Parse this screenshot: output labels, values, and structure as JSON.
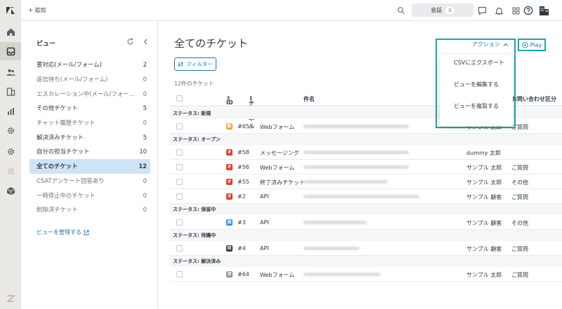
{
  "topbar": {
    "add_label": "+ 追加",
    "conversations_label": "会話",
    "conversations_count": "0"
  },
  "views": {
    "title": "ビュー",
    "items": [
      {
        "label": "要対応(メール/フォーム)",
        "count": "2",
        "dim": false
      },
      {
        "label": "返信待ち(メール/フォーム)",
        "count": "0",
        "dim": true
      },
      {
        "label": "エスカレーション中(メール/フォー…",
        "count": "0",
        "dim": true
      },
      {
        "label": "その他チケット",
        "count": "5",
        "dim": false
      },
      {
        "label": "チャット履歴チケット",
        "count": "0",
        "dim": true
      },
      {
        "label": "解決済みチケット",
        "count": "5",
        "dim": false
      },
      {
        "label": "自分の担当チケット",
        "count": "10",
        "dim": false
      },
      {
        "label": "全てのチケット",
        "count": "12",
        "dim": false,
        "active": true
      },
      {
        "label": "CSATアンケート回答あり",
        "count": "0",
        "dim": true
      },
      {
        "label": "一時停止中のチケット",
        "count": "0",
        "dim": true
      },
      {
        "label": "削除済チケット",
        "count": "0",
        "dim": true
      }
    ],
    "manage_label": "ビューを管理する"
  },
  "main": {
    "title": "全てのチケット",
    "filter_label": "フィルター",
    "count_label": "12件のチケット",
    "action_label": "アクション",
    "play_label": "Play",
    "menu": [
      "CSVにエクスポート",
      "ビューを編集する",
      "ビューを複製する"
    ]
  },
  "table": {
    "headers": {
      "id": "ID",
      "channel": "チャネル",
      "subject": "件名",
      "type": "お問い合わせ区分"
    },
    "groups": [
      {
        "label": "ステータス: 新規",
        "rows": [
          {
            "badge": "新",
            "color": "#e8a33c",
            "id": "#65",
            "channel": "Webフォーム",
            "requester": "サンプル 太郎",
            "type": "ご質問"
          }
        ]
      },
      {
        "label": "ステータス: オープン",
        "rows": [
          {
            "badge": "オ",
            "color": "#d93f2c",
            "id": "#58",
            "channel": "メッセージング",
            "requester": "dummy 太郎",
            "type": ""
          },
          {
            "badge": "オ",
            "color": "#d93f2c",
            "id": "#56",
            "channel": "Webフォーム",
            "requester": "サンプル 太郎",
            "type": "ご質問"
          },
          {
            "badge": "オ",
            "color": "#d93f2c",
            "id": "#55",
            "channel": "終了済みチケット",
            "requester": "サンプル 太郎",
            "type": "その他"
          },
          {
            "badge": "オ",
            "color": "#d93f2c",
            "id": "#2",
            "channel": "API",
            "requester": "サンプル 顧客",
            "type": "ご質問"
          }
        ]
      },
      {
        "label": "ステータス: 保留中",
        "rows": [
          {
            "badge": "保",
            "color": "#3a8de0",
            "id": "#3",
            "channel": "API",
            "requester": "サンプル 顧客",
            "type": "その他"
          }
        ]
      },
      {
        "label": "ステータス: 待機中",
        "rows": [
          {
            "badge": "待",
            "color": "#2f3941",
            "id": "#4",
            "channel": "API",
            "requester": "サンプル 顧客",
            "type": "ご質問"
          }
        ]
      },
      {
        "label": "ステータス: 解決済み",
        "rows": [
          {
            "badge": "済",
            "color": "#87929d",
            "id": "#64",
            "channel": "Webフォーム",
            "requester": "サンプル 太郎",
            "type": "ご質問"
          }
        ]
      }
    ]
  }
}
